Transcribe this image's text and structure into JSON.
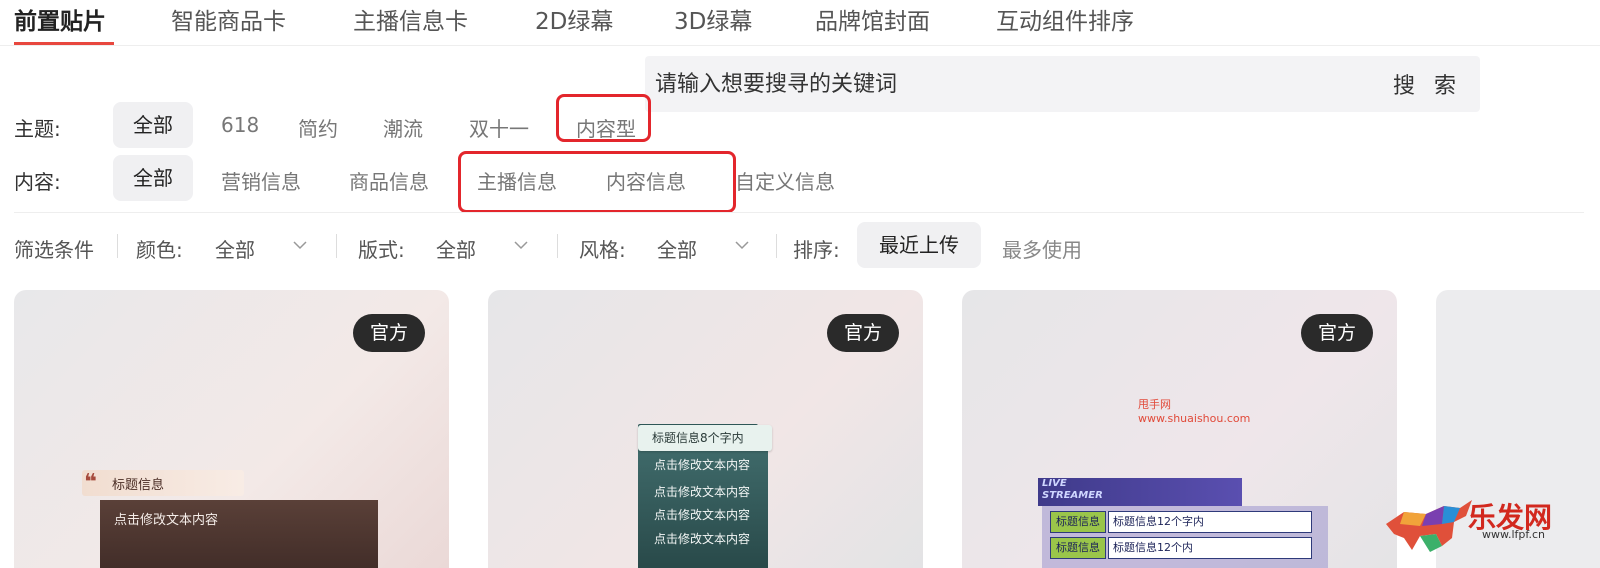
{
  "tabs": [
    {
      "label": "前置贴片",
      "active": true
    },
    {
      "label": "智能商品卡"
    },
    {
      "label": "主播信息卡"
    },
    {
      "label": "2D绿幕"
    },
    {
      "label": "3D绿幕"
    },
    {
      "label": "品牌馆封面"
    },
    {
      "label": "互动组件排序"
    }
  ],
  "search": {
    "placeholder": "请输入想要搜寻的关键词",
    "button": "搜 索"
  },
  "theme": {
    "label": "主题:",
    "options": [
      "全部",
      "618",
      "简约",
      "潮流",
      "双十一",
      "内容型"
    ],
    "selected": "全部"
  },
  "content": {
    "label": "内容:",
    "options": [
      "全部",
      "营销信息",
      "商品信息",
      "主播信息",
      "内容信息",
      "自定义信息"
    ],
    "selected": "全部"
  },
  "filters": {
    "title": "筛选条件",
    "color_label": "颜色:",
    "color_value": "全部",
    "layout_label": "版式:",
    "layout_value": "全部",
    "style_label": "风格:",
    "style_value": "全部",
    "sort_label": "排序:",
    "sort_options": [
      "最近上传",
      "最多使用"
    ],
    "sort_selected": "最近上传"
  },
  "cards": [
    {
      "badge": "官方",
      "title": "标题信息",
      "body": "点击修改文本内容"
    },
    {
      "badge": "官方",
      "title": "标题信息8个字内",
      "lines": [
        "点击修改文本内容",
        "点击修改文本内容",
        "点击修改文本内容",
        "点击修改文本内容"
      ]
    },
    {
      "badge": "官方",
      "watermark_name": "甩手网",
      "watermark_url": "www.shuaishou.com",
      "live_line1": "LIVE",
      "live_line2": "STREAMER",
      "rows": [
        {
          "label": "标题信息",
          "value": "标题信息12个字内"
        },
        {
          "label": "标题信息",
          "value": "标题信息12个内"
        }
      ]
    }
  ],
  "watermark": {
    "text": "乐发网",
    "url": "www.lfpf.cn"
  },
  "colors": {
    "accent": "#e8473e",
    "highlight_box": "#e3262c"
  }
}
